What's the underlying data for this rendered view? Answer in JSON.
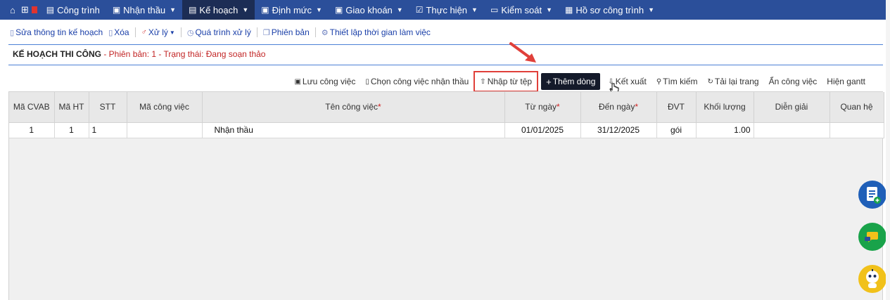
{
  "nav": {
    "items": [
      {
        "label": "Công trình",
        "icon": "table-icon",
        "chevron": false,
        "active": false
      },
      {
        "label": "Nhận thầu",
        "icon": "doc-icon",
        "chevron": true,
        "active": false
      },
      {
        "label": "Kế hoạch",
        "icon": "table-icon",
        "chevron": true,
        "active": true
      },
      {
        "label": "Định mức",
        "icon": "doc-icon",
        "chevron": true,
        "active": false
      },
      {
        "label": "Giao khoán",
        "icon": "doc-icon",
        "chevron": true,
        "active": false
      },
      {
        "label": "Thực hiện",
        "icon": "check-icon",
        "chevron": true,
        "active": false
      },
      {
        "label": "Kiểm soát",
        "icon": "monitor-icon",
        "chevron": true,
        "active": false
      },
      {
        "label": "Hồ sơ công trình",
        "icon": "briefcase-icon",
        "chevron": true,
        "active": false
      }
    ]
  },
  "toolbar": {
    "edit_label": "Sửa thông tin kế hoạch",
    "delete_label": "Xóa",
    "process_label": "Xử lý",
    "history_label": "Quá trình xử lý",
    "version_label": "Phiên bản",
    "settings_label": "Thiết lập thời gian làm việc"
  },
  "page": {
    "title": "KẾ HOẠCH THI CÔNG",
    "subtitle": " - Phiên bản: 1 - Trạng thái: Đang soạn thảo"
  },
  "actions": {
    "save": "Lưu công việc",
    "choose": "Chọn công việc nhận thầu",
    "import": "Nhập từ tệp",
    "add_row": "Thêm dòng",
    "export": "Kết xuất",
    "search": "Tìm kiếm",
    "reload": "Tải lại trang",
    "hide": "Ẩn công việc",
    "gantt": "Hiện gantt"
  },
  "table": {
    "headers": [
      "Mã CVAB",
      "Mã HT",
      "STT",
      "Mã công việc",
      "Tên công việc",
      "Từ ngày",
      "Đến ngày",
      "ĐVT",
      "Khối lượng",
      "Diễn giải",
      "Quan hệ"
    ],
    "required": [
      "Tên công việc",
      "Từ ngày",
      "Đến ngày"
    ],
    "rows": [
      {
        "ma_cvab": "1",
        "ma_ht": "1",
        "stt": "1",
        "ma_cv": "",
        "ten_cv": "Nhận thầu",
        "tu_ngay": "01/01/2025",
        "den_ngay": "31/12/2025",
        "dvt": "gói",
        "khoi_luong": "1.00",
        "dien_giai": "",
        "quan_he": ""
      }
    ]
  },
  "colors": {
    "nav_bg": "#2b4f9a",
    "nav_active": "#1c2d55",
    "link_blue": "#1a3fa8",
    "status_red": "#c22525",
    "highlight_red": "#e0403a"
  }
}
